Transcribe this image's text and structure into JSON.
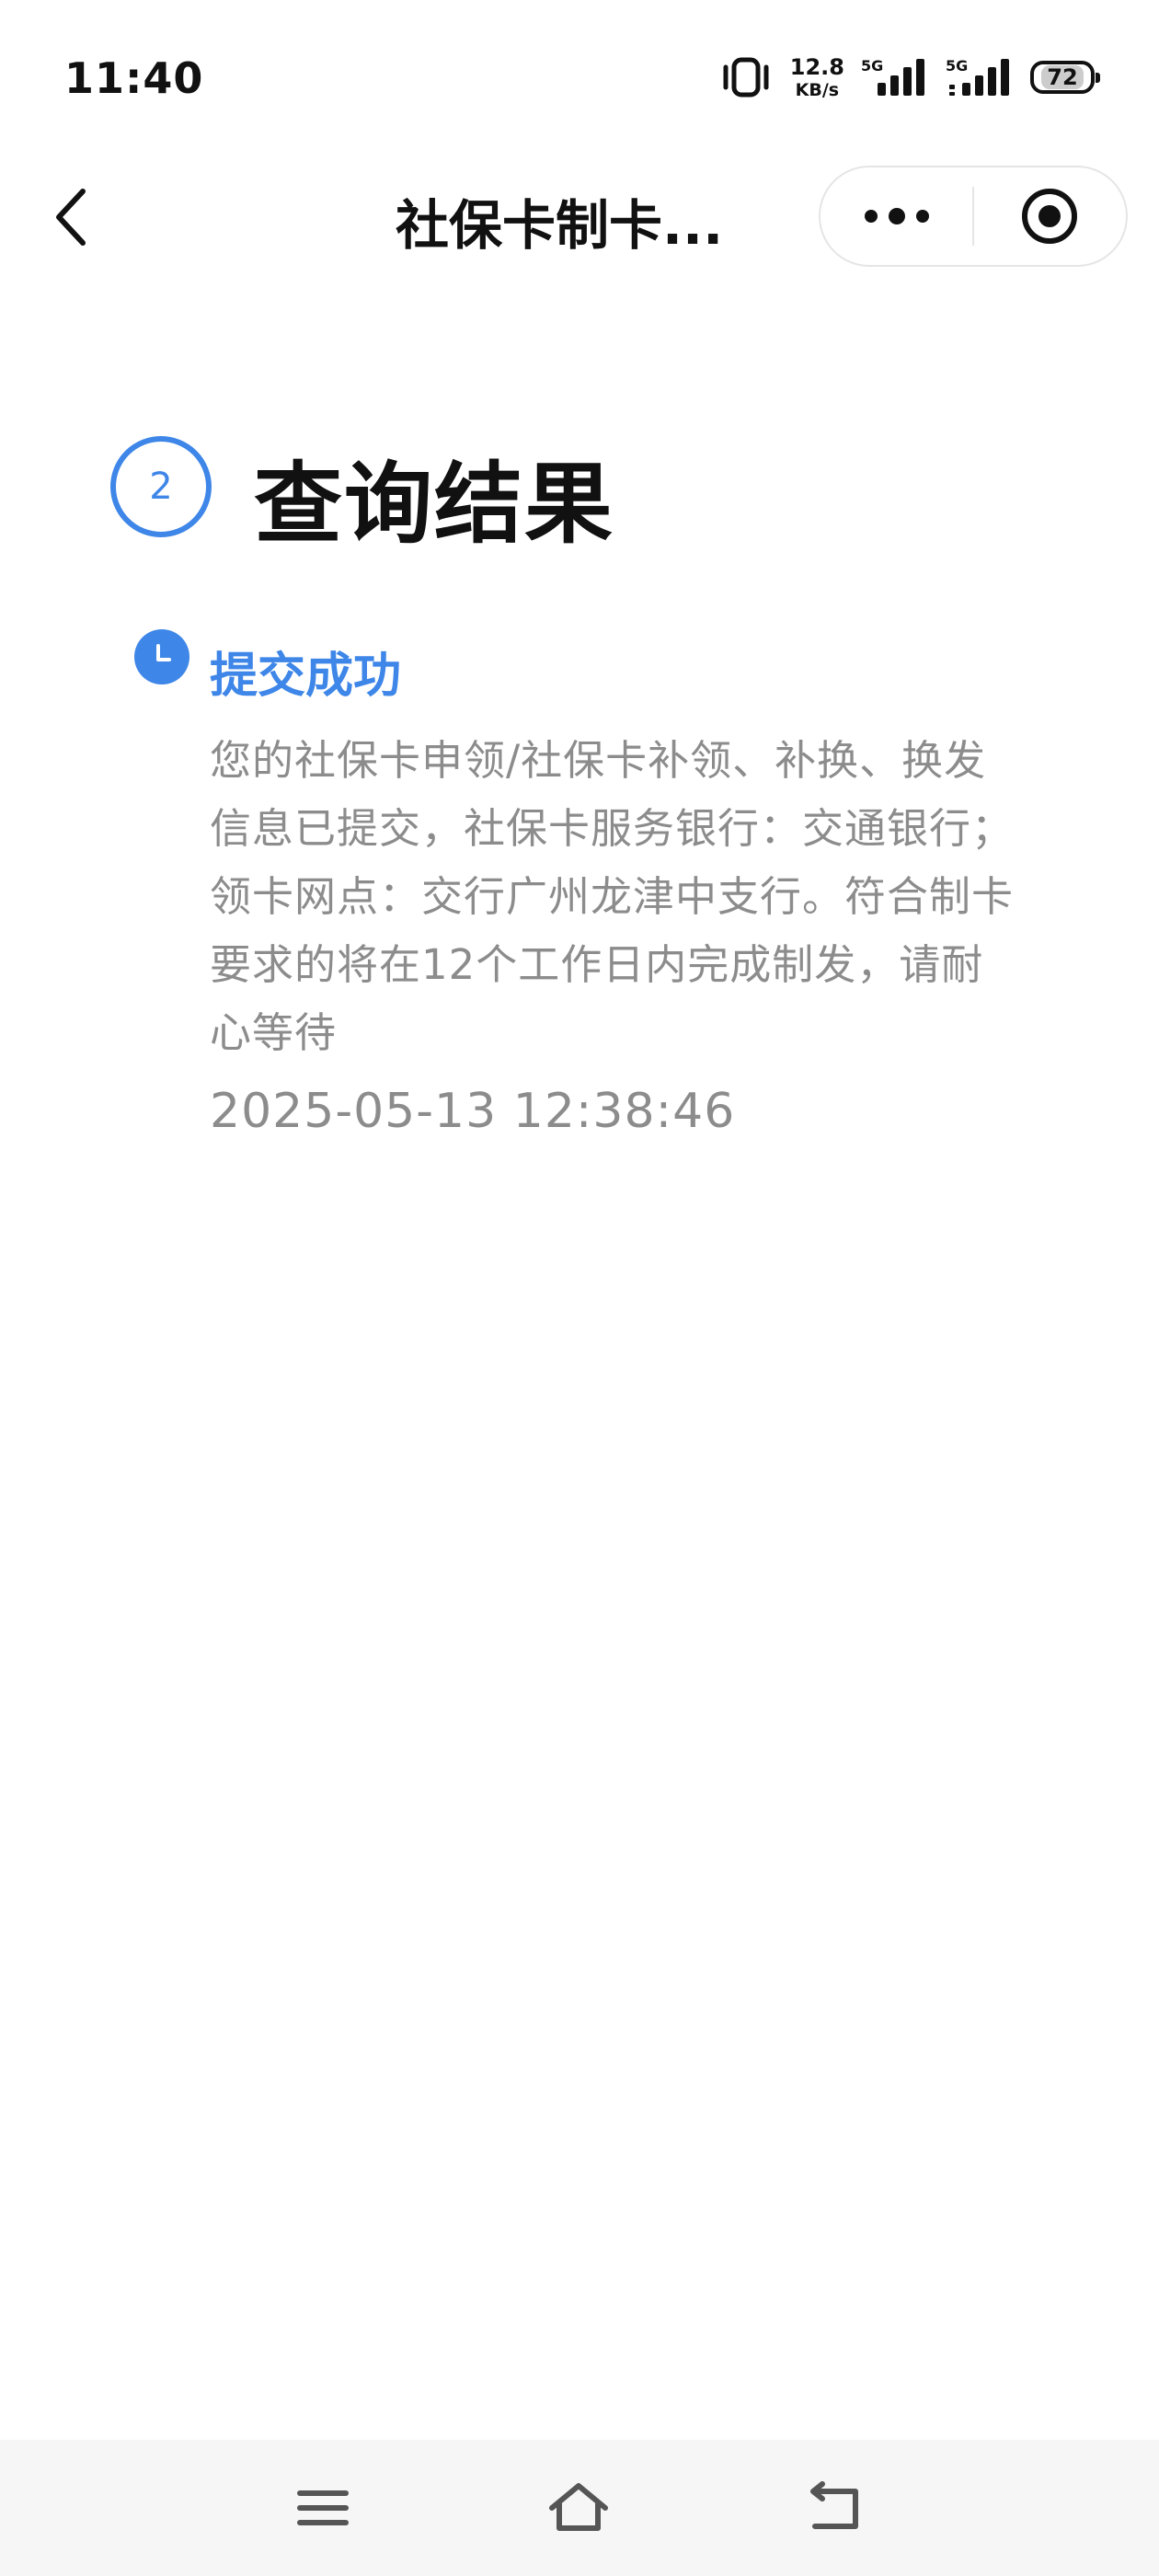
{
  "status_bar": {
    "time": "11:40",
    "net_speed_value": "12.8",
    "net_speed_unit": "KB/s",
    "sim1_tag": "5G",
    "sim2_tag": "5G",
    "battery_level": "72",
    "icons": [
      "vibrate-icon",
      "signal-icon",
      "battery-icon"
    ]
  },
  "nav": {
    "title": "社保卡制卡...",
    "icons": [
      "back-icon",
      "more-icon",
      "target-icon"
    ]
  },
  "result": {
    "step_number": "2",
    "title": "查询结果",
    "status": {
      "label": "提交成功",
      "icon": "clock-icon",
      "description": "您的社保卡申领/社保卡补领、补换、换发信息已提交，社保卡服务银行：交通银行；领卡网点：交行广州龙津中支行。符合制卡要求的将在12个工作日内完成制发，请耐心等待",
      "timestamp": "2025-05-13 12:38:46"
    }
  },
  "colors": {
    "accent": "#3e86e8",
    "text_primary": "#111111",
    "text_secondary": "#8c8c8c",
    "bottom_bar": "#f6f6f6"
  },
  "bottom_nav": {
    "icons": [
      "menu-icon",
      "home-icon",
      "return-icon"
    ]
  }
}
